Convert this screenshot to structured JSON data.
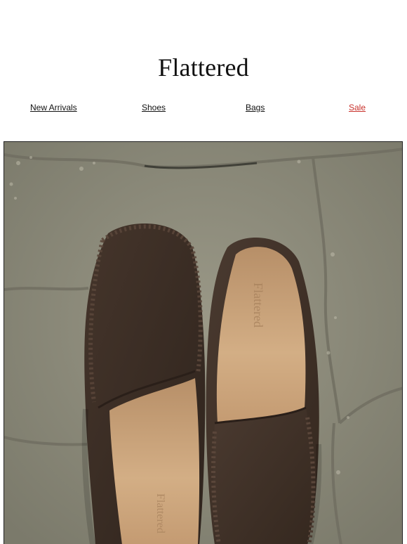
{
  "brand": {
    "name": "Flattered"
  },
  "nav": {
    "items": [
      {
        "label": "New Arrivals"
      },
      {
        "label": "Shoes"
      },
      {
        "label": "Bags"
      },
      {
        "label": "Sale"
      }
    ]
  },
  "hero": {
    "imprint": "Flattered",
    "colors": {
      "suede": "#3f3027",
      "lining": "#c9a47c",
      "stone": "#8d8b7c",
      "sale": "#c8302a"
    }
  }
}
